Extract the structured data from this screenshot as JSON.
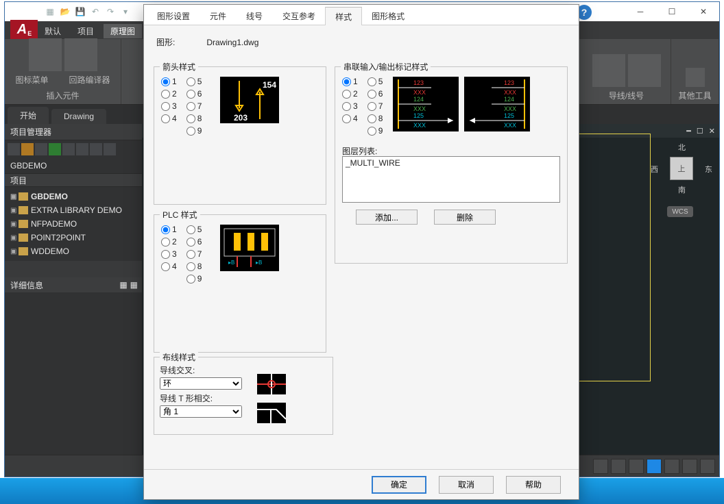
{
  "window": {
    "help_tooltip": "?",
    "minimize": "─",
    "maximize": "☐",
    "close": "✕",
    "app_letter": "A",
    "app_sub": "E"
  },
  "ribbon": {
    "tabs": [
      "默认",
      "项目",
      "原理图"
    ],
    "active_tab": 2,
    "panels": {
      "p0a": "图标菜单",
      "p0b": "回路编译器",
      "p0_label": "插入元件",
      "p1": "导线/线号",
      "p2": "其他工具"
    }
  },
  "drawing_tabs": [
    "开始",
    "Drawing"
  ],
  "left_panel": {
    "title": "项目管理器",
    "project": "GBDEMO",
    "section_projects": "项目",
    "items": [
      {
        "label": "GBDEMO",
        "bold": true
      },
      {
        "label": "EXTRA LIBRARY DEMO"
      },
      {
        "label": "NFPADEMO"
      },
      {
        "label": "POINT2POINT"
      },
      {
        "label": "WDDEMO"
      }
    ],
    "section_detail": "详细信息"
  },
  "viewcube": {
    "top": "北",
    "bottom": "南",
    "left": "西",
    "right": "东",
    "face": "上",
    "wcs": "WCS"
  },
  "canvas_hdr": {
    "min": "━",
    "max": "☐",
    "x": "✕"
  },
  "dialog": {
    "tabs": [
      "图形设置",
      "元件",
      "线号",
      "交互参考",
      "样式",
      "图形格式"
    ],
    "active_tab": 4,
    "drawing_label": "图形:",
    "drawing_value": "Drawing1.dwg",
    "groups": {
      "arrow": "箭头样式",
      "plc": "PLC 样式",
      "wire": "布线样式",
      "io": "串联输入/输出标记样式"
    },
    "radios": [
      "1",
      "2",
      "3",
      "4",
      "5",
      "6",
      "7",
      "8",
      "9"
    ],
    "arrow_preview": {
      "top": "154",
      "bot": "203"
    },
    "io_preview": {
      "a": "123",
      "b": "124",
      "c": "125",
      "x": "XXX"
    },
    "wire": {
      "cross_label": "导线交叉:",
      "cross_value": "环",
      "tee_label": "导线 T 形相交:",
      "tee_value": "角 1"
    },
    "io": {
      "layer_label": "图层列表:",
      "layer_value": "_MULTI_WIRE",
      "btn_add": "添加...",
      "btn_del": "删除"
    },
    "footer": {
      "ok": "确定",
      "cancel": "取消",
      "help": "帮助"
    }
  }
}
